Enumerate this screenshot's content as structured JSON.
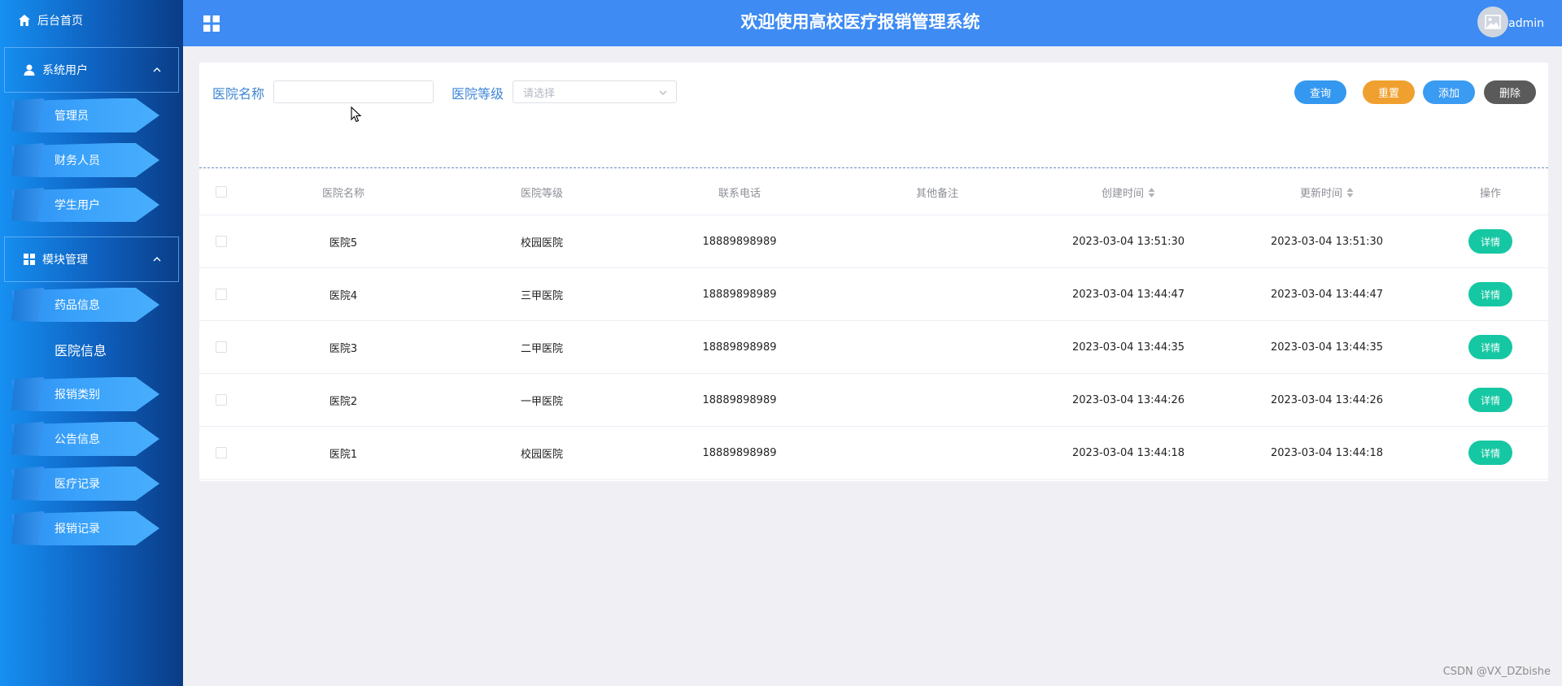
{
  "sidebar": {
    "home": "后台首页",
    "groups": [
      {
        "label": "系统用户",
        "items": [
          "管理员",
          "财务人员",
          "学生用户"
        ]
      },
      {
        "label": "模块管理",
        "items": [
          "药品信息",
          "医院信息",
          "报销类别",
          "公告信息",
          "医疗记录",
          "报销记录"
        ]
      }
    ]
  },
  "header": {
    "title": "欢迎使用高校医疗报销管理系统",
    "user": "admin"
  },
  "search": {
    "name_label": "医院名称",
    "name_value": "",
    "level_label": "医院等级",
    "level_placeholder": "请选择"
  },
  "buttons": {
    "query": "查询",
    "reset": "重置",
    "add": "添加",
    "delete": "删除"
  },
  "table": {
    "columns": [
      "医院名称",
      "医院等级",
      "联系电话",
      "其他备注",
      "创建时间",
      "更新时间",
      "操作"
    ],
    "rows": [
      {
        "name": "医院5",
        "level": "校园医院",
        "phone": "18889898989",
        "note": "",
        "created": "2023-03-04 13:51:30",
        "updated": "2023-03-04 13:51:30",
        "action": "详情"
      },
      {
        "name": "医院4",
        "level": "三甲医院",
        "phone": "18889898989",
        "note": "",
        "created": "2023-03-04 13:44:47",
        "updated": "2023-03-04 13:44:47",
        "action": "详情"
      },
      {
        "name": "医院3",
        "level": "二甲医院",
        "phone": "18889898989",
        "note": "",
        "created": "2023-03-04 13:44:35",
        "updated": "2023-03-04 13:44:35",
        "action": "详情"
      },
      {
        "name": "医院2",
        "level": "一甲医院",
        "phone": "18889898989",
        "note": "",
        "created": "2023-03-04 13:44:26",
        "updated": "2023-03-04 13:44:26",
        "action": "详情"
      },
      {
        "name": "医院1",
        "level": "校园医院",
        "phone": "18889898989",
        "note": "",
        "created": "2023-03-04 13:44:18",
        "updated": "2023-03-04 13:44:18",
        "action": "详情"
      }
    ]
  },
  "watermark": "CSDN @VX_DZbishe",
  "colors": {
    "header": "#3d8bf3",
    "detail": "#16c7a3",
    "reset": "#f0a02e",
    "delete": "#5a5a5a"
  }
}
